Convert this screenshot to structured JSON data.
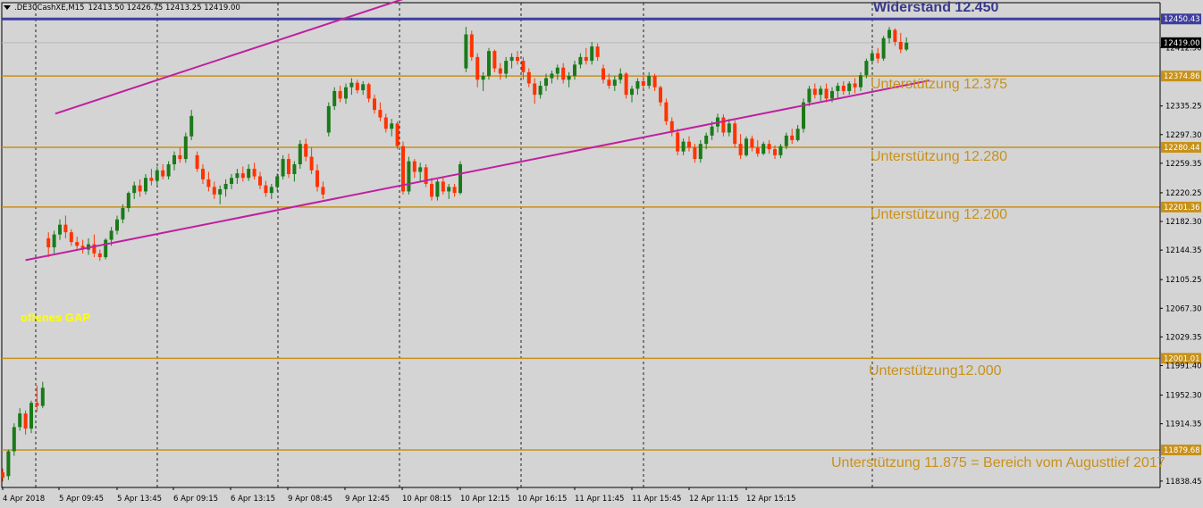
{
  "header": {
    "symbol": ".DE30CashXE,M15",
    "ohlc": "12413.50 12426.75 12413.25 12419.00"
  },
  "annotations": {
    "resistance": "Widerstand 12.450",
    "support_12375": "Unterstützung 12.375",
    "support_12280": "Unterstützung 12.280",
    "support_12200": "Unterstützung 12.200",
    "support_12000": "Unterstützung12.000",
    "support_11875": "Unterstützung 11.875 = Bereich vom Augusttief 2017",
    "gap": "offenes GAP"
  },
  "colors": {
    "background": "#d4d4d4",
    "bull": "#1a7a1a",
    "bear": "#ff3300",
    "support_line": "#c8911a",
    "resistance_line": "#3f3f9e",
    "trend_line": "#c020a0",
    "gap_text": "#ffff00"
  },
  "chart_data": {
    "type": "candlestick",
    "timeframe": "M15",
    "y_ticks": [
      "12450.43",
      "12419.00",
      "12412.50",
      "12374.86",
      "12335.25",
      "12297.30",
      "12280.44",
      "12259.35",
      "12220.25",
      "12201.36",
      "12182.30",
      "12144.35",
      "12105.25",
      "12067.30",
      "12029.35",
      "12001.01",
      "11991.40",
      "11952.30",
      "11914.35",
      "11879.68",
      "11838.45"
    ],
    "x_ticks": [
      "4 Apr 2018",
      "5 Apr 09:45",
      "5 Apr 13:45",
      "6 Apr 09:15",
      "6 Apr 13:15",
      "9 Apr 08:45",
      "9 Apr 12:45",
      "10 Apr 08:15",
      "10 Apr 12:15",
      "10 Apr 16:15",
      "11 Apr 11:45",
      "11 Apr 15:45",
      "12 Apr 11:15",
      "12 Apr 15:15"
    ],
    "ylim": [
      11830,
      12472
    ],
    "horizontal_levels": [
      {
        "value": 12450.43,
        "label": "12450.43",
        "kind": "resistance"
      },
      {
        "value": 12374.86,
        "label": "12374.86",
        "kind": "support"
      },
      {
        "value": 12280.44,
        "label": "12280.44",
        "kind": "support"
      },
      {
        "value": 12201.36,
        "label": "12201.36",
        "kind": "support"
      },
      {
        "value": 12001.01,
        "label": "12001.01",
        "kind": "support"
      },
      {
        "value": 11879.68,
        "label": "11879.68",
        "kind": "support"
      }
    ],
    "current_price": {
      "value": 12419.0,
      "label": "12419.00"
    },
    "trendlines": [
      {
        "x1": 9.2,
        "y1": 12325,
        "x2": 70.5,
        "y2": 12478
      },
      {
        "x1": 4.0,
        "y1": 12131,
        "x2": 162.0,
        "y2": 12369
      }
    ],
    "candles": [
      [
        0,
        11850,
        11855,
        11838,
        11843
      ],
      [
        1,
        11845,
        11880,
        11840,
        11878
      ],
      [
        2,
        11878,
        11915,
        11872,
        11910
      ],
      [
        3,
        11910,
        11935,
        11905,
        11928
      ],
      [
        4,
        11928,
        11932,
        11900,
        11908
      ],
      [
        5,
        11908,
        11945,
        11902,
        11942
      ],
      [
        6,
        11942,
        11965,
        11930,
        11938
      ],
      [
        7,
        11938,
        11970,
        11935,
        11962
      ],
      [
        8,
        12160,
        12168,
        12135,
        12148
      ],
      [
        9,
        12148,
        12170,
        12140,
        12165
      ],
      [
        10,
        12165,
        12185,
        12158,
        12178
      ],
      [
        11,
        12178,
        12190,
        12160,
        12168
      ],
      [
        12,
        12168,
        12172,
        12150,
        12155
      ],
      [
        13,
        12155,
        12162,
        12145,
        12150
      ],
      [
        14,
        12150,
        12158,
        12140,
        12145
      ],
      [
        15,
        12145,
        12160,
        12138,
        12152
      ],
      [
        16,
        12152,
        12165,
        12135,
        12140
      ],
      [
        17,
        12140,
        12145,
        12130,
        12135
      ],
      [
        18,
        12135,
        12160,
        12132,
        12158
      ],
      [
        19,
        12158,
        12175,
        12150,
        12170
      ],
      [
        20,
        12170,
        12190,
        12165,
        12185
      ],
      [
        21,
        12185,
        12205,
        12180,
        12200
      ],
      [
        22,
        12200,
        12222,
        12195,
        12220
      ],
      [
        23,
        12220,
        12235,
        12212,
        12230
      ],
      [
        24,
        12230,
        12238,
        12215,
        12222
      ],
      [
        25,
        12222,
        12245,
        12218,
        12240
      ],
      [
        26,
        12240,
        12252,
        12230,
        12236
      ],
      [
        27,
        12236,
        12255,
        12230,
        12250
      ],
      [
        28,
        12250,
        12258,
        12238,
        12242
      ],
      [
        29,
        12242,
        12262,
        12238,
        12258
      ],
      [
        30,
        12258,
        12275,
        12250,
        12270
      ],
      [
        31,
        12270,
        12280,
        12260,
        12265
      ],
      [
        32,
        12265,
        12300,
        12260,
        12295
      ],
      [
        33,
        12295,
        12330,
        12290,
        12322
      ],
      [
        34,
        12270,
        12275,
        12248,
        12252
      ],
      [
        35,
        12252,
        12258,
        12232,
        12238
      ],
      [
        36,
        12238,
        12248,
        12222,
        12228
      ],
      [
        37,
        12228,
        12235,
        12212,
        12218
      ],
      [
        38,
        12218,
        12230,
        12205,
        12225
      ],
      [
        39,
        12225,
        12238,
        12215,
        12232
      ],
      [
        40,
        12232,
        12245,
        12225,
        12240
      ],
      [
        41,
        12240,
        12252,
        12232,
        12246
      ],
      [
        42,
        12246,
        12255,
        12235,
        12240
      ],
      [
        43,
        12240,
        12258,
        12236,
        12252
      ],
      [
        44,
        12252,
        12260,
        12238,
        12242
      ],
      [
        45,
        12242,
        12248,
        12225,
        12230
      ],
      [
        46,
        12230,
        12236,
        12215,
        12220
      ],
      [
        47,
        12220,
        12232,
        12212,
        12228
      ],
      [
        48,
        12228,
        12246,
        12222,
        12242
      ],
      [
        49,
        12242,
        12270,
        12238,
        12265
      ],
      [
        50,
        12265,
        12272,
        12240,
        12245
      ],
      [
        51,
        12245,
        12262,
        12235,
        12258
      ],
      [
        52,
        12258,
        12290,
        12252,
        12285
      ],
      [
        53,
        12285,
        12292,
        12262,
        12268
      ],
      [
        54,
        12268,
        12280,
        12245,
        12250
      ],
      [
        55,
        12250,
        12258,
        12222,
        12228
      ],
      [
        56,
        12228,
        12235,
        12212,
        12218
      ],
      [
        57,
        12300,
        12340,
        12295,
        12335
      ],
      [
        58,
        12335,
        12360,
        12330,
        12355
      ],
      [
        59,
        12355,
        12362,
        12340,
        12345
      ],
      [
        60,
        12345,
        12365,
        12338,
        12360
      ],
      [
        61,
        12360,
        12372,
        12350,
        12366
      ],
      [
        62,
        12366,
        12370,
        12352,
        12356
      ],
      [
        63,
        12356,
        12368,
        12350,
        12364
      ],
      [
        64,
        12364,
        12366,
        12340,
        12345
      ],
      [
        65,
        12345,
        12350,
        12325,
        12330
      ],
      [
        66,
        12330,
        12340,
        12315,
        12320
      ],
      [
        67,
        12320,
        12325,
        12300,
        12305
      ],
      [
        68,
        12305,
        12318,
        12295,
        12312
      ],
      [
        69,
        12312,
        12315,
        12278,
        12282
      ],
      [
        70,
        12282,
        12288,
        12218,
        12222
      ],
      [
        71,
        12222,
        12268,
        12218,
        12262
      ],
      [
        72,
        12262,
        12265,
        12240,
        12248
      ],
      [
        73,
        12248,
        12260,
        12235,
        12254
      ],
      [
        74,
        12254,
        12258,
        12228,
        12232
      ],
      [
        75,
        12232,
        12240,
        12210,
        12215
      ],
      [
        76,
        12215,
        12238,
        12210,
        12235
      ],
      [
        77,
        12235,
        12240,
        12218,
        12222
      ],
      [
        78,
        12222,
        12232,
        12212,
        12228
      ],
      [
        79,
        12228,
        12232,
        12215,
        12220
      ],
      [
        80,
        12220,
        12262,
        12218,
        12258
      ],
      [
        81,
        12385,
        12440,
        12380,
        12430
      ],
      [
        82,
        12430,
        12435,
        12395,
        12400
      ],
      [
        83,
        12400,
        12405,
        12360,
        12370
      ],
      [
        84,
        12370,
        12380,
        12355,
        12375
      ],
      [
        85,
        12375,
        12412,
        12370,
        12408
      ],
      [
        86,
        12408,
        12410,
        12380,
        12385
      ],
      [
        87,
        12385,
        12392,
        12370,
        12378
      ],
      [
        88,
        12378,
        12400,
        12372,
        12395
      ],
      [
        89,
        12395,
        12405,
        12385,
        12400
      ],
      [
        90,
        12400,
        12408,
        12390,
        12395
      ],
      [
        91,
        12395,
        12400,
        12370,
        12380
      ],
      [
        92,
        12380,
        12385,
        12360,
        12365
      ],
      [
        93,
        12365,
        12372,
        12338,
        12350
      ],
      [
        94,
        12350,
        12368,
        12345,
        12362
      ],
      [
        95,
        12362,
        12378,
        12355,
        12372
      ],
      [
        96,
        12372,
        12382,
        12365,
        12378
      ],
      [
        97,
        12378,
        12390,
        12370,
        12386
      ],
      [
        98,
        12386,
        12392,
        12365,
        12370
      ],
      [
        99,
        12370,
        12380,
        12360,
        12375
      ],
      [
        100,
        12375,
        12395,
        12370,
        12390
      ],
      [
        101,
        12390,
        12405,
        12385,
        12400
      ],
      [
        102,
        12400,
        12412,
        12390,
        12395
      ],
      [
        103,
        12395,
        12420,
        12390,
        12414
      ],
      [
        104,
        12414,
        12418,
        12395,
        12400
      ],
      [
        105,
        12385,
        12390,
        12365,
        12370
      ],
      [
        106,
        12370,
        12378,
        12358,
        12362
      ],
      [
        107,
        12362,
        12375,
        12355,
        12370
      ],
      [
        108,
        12370,
        12385,
        12365,
        12378
      ],
      [
        109,
        12378,
        12380,
        12345,
        12350
      ],
      [
        110,
        12350,
        12362,
        12340,
        12358
      ],
      [
        111,
        12358,
        12372,
        12350,
        12368
      ],
      [
        112,
        12368,
        12375,
        12358,
        12362
      ],
      [
        113,
        12362,
        12380,
        12358,
        12375
      ],
      [
        114,
        12375,
        12378,
        12355,
        12360
      ],
      [
        115,
        12360,
        12362,
        12335,
        12340
      ],
      [
        116,
        12340,
        12345,
        12310,
        12315
      ],
      [
        117,
        12315,
        12320,
        12295,
        12300
      ],
      [
        118,
        12300,
        12305,
        12270,
        12275
      ],
      [
        119,
        12275,
        12292,
        12270,
        12288
      ],
      [
        120,
        12288,
        12295,
        12275,
        12280
      ],
      [
        121,
        12280,
        12285,
        12260,
        12265
      ],
      [
        122,
        12265,
        12290,
        12260,
        12285
      ],
      [
        123,
        12285,
        12300,
        12278,
        12296
      ],
      [
        124,
        12296,
        12315,
        12290,
        12308
      ],
      [
        125,
        12308,
        12325,
        12300,
        12320
      ],
      [
        126,
        12320,
        12324,
        12295,
        12300
      ],
      [
        127,
        12300,
        12318,
        12295,
        12312
      ],
      [
        128,
        12312,
        12316,
        12280,
        12285
      ],
      [
        129,
        12285,
        12298,
        12265,
        12270
      ],
      [
        130,
        12270,
        12295,
        12268,
        12292
      ],
      [
        131,
        12292,
        12296,
        12275,
        12280
      ],
      [
        132,
        12280,
        12290,
        12268,
        12272
      ],
      [
        133,
        12272,
        12288,
        12270,
        12285
      ],
      [
        134,
        12285,
        12290,
        12272,
        12278
      ],
      [
        135,
        12278,
        12283,
        12265,
        12270
      ],
      [
        136,
        12270,
        12285,
        12266,
        12282
      ],
      [
        137,
        12282,
        12300,
        12278,
        12296
      ],
      [
        138,
        12296,
        12305,
        12285,
        12290
      ],
      [
        139,
        12290,
        12310,
        12288,
        12305
      ],
      [
        140,
        12305,
        12345,
        12300,
        12340
      ],
      [
        141,
        12340,
        12362,
        12335,
        12358
      ],
      [
        142,
        12358,
        12365,
        12345,
        12350
      ],
      [
        143,
        12350,
        12362,
        12342,
        12358
      ],
      [
        144,
        12358,
        12365,
        12340,
        12345
      ],
      [
        145,
        12345,
        12360,
        12340,
        12355
      ],
      [
        146,
        12355,
        12366,
        12345,
        12362
      ],
      [
        147,
        12362,
        12368,
        12350,
        12355
      ],
      [
        148,
        12355,
        12368,
        12350,
        12365
      ],
      [
        149,
        12365,
        12372,
        12352,
        12360
      ],
      [
        150,
        12360,
        12380,
        12355,
        12376
      ],
      [
        151,
        12376,
        12398,
        12372,
        12395
      ],
      [
        152,
        12395,
        12410,
        12390,
        12405
      ],
      [
        153,
        12405,
        12412,
        12392,
        12398
      ],
      [
        154,
        12398,
        12428,
        12395,
        12425
      ],
      [
        155,
        12425,
        12440,
        12418,
        12436
      ],
      [
        156,
        12436,
        12438,
        12415,
        12420
      ],
      [
        157,
        12420,
        12432,
        12405,
        12410
      ],
      [
        158,
        12410,
        12426,
        12408,
        12419
      ]
    ]
  }
}
